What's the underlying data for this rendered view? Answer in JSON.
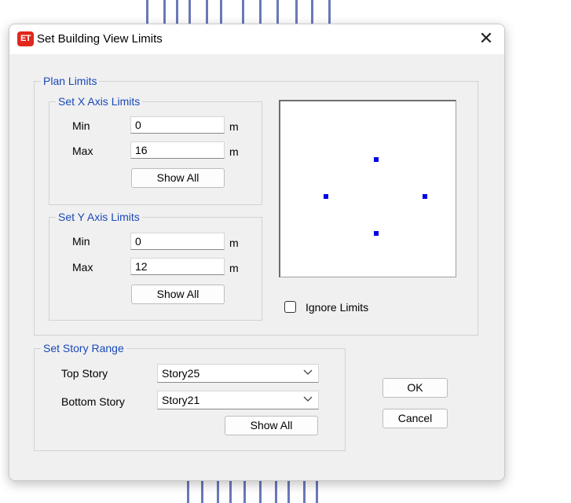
{
  "window": {
    "icon_text": "ET",
    "title": "Set Building View Limits"
  },
  "plan_limits": {
    "label": "Plan Limits",
    "x_axis": {
      "label": "Set X Axis Limits",
      "min_label": "Min",
      "min_value": "0",
      "max_label": "Max",
      "max_value": "16",
      "unit": "m",
      "show_all_label": "Show All"
    },
    "y_axis": {
      "label": "Set Y Axis Limits",
      "min_label": "Min",
      "min_value": "0",
      "max_label": "Max",
      "max_value": "12",
      "unit": "m",
      "show_all_label": "Show All"
    },
    "ignore_limits_label": "Ignore Limits",
    "ignore_limits_checked": false
  },
  "story_range": {
    "label": "Set Story Range",
    "top_story_label": "Top Story",
    "top_story_value": "Story25",
    "bottom_story_label": "Bottom Story",
    "bottom_story_value": "Story21",
    "show_all_label": "Show All"
  },
  "buttons": {
    "ok_label": "OK",
    "cancel_label": "Cancel"
  },
  "colors": {
    "group_label": "#1a49b8",
    "preview_handle": "#0000e6",
    "app_icon": "#e0281c"
  }
}
